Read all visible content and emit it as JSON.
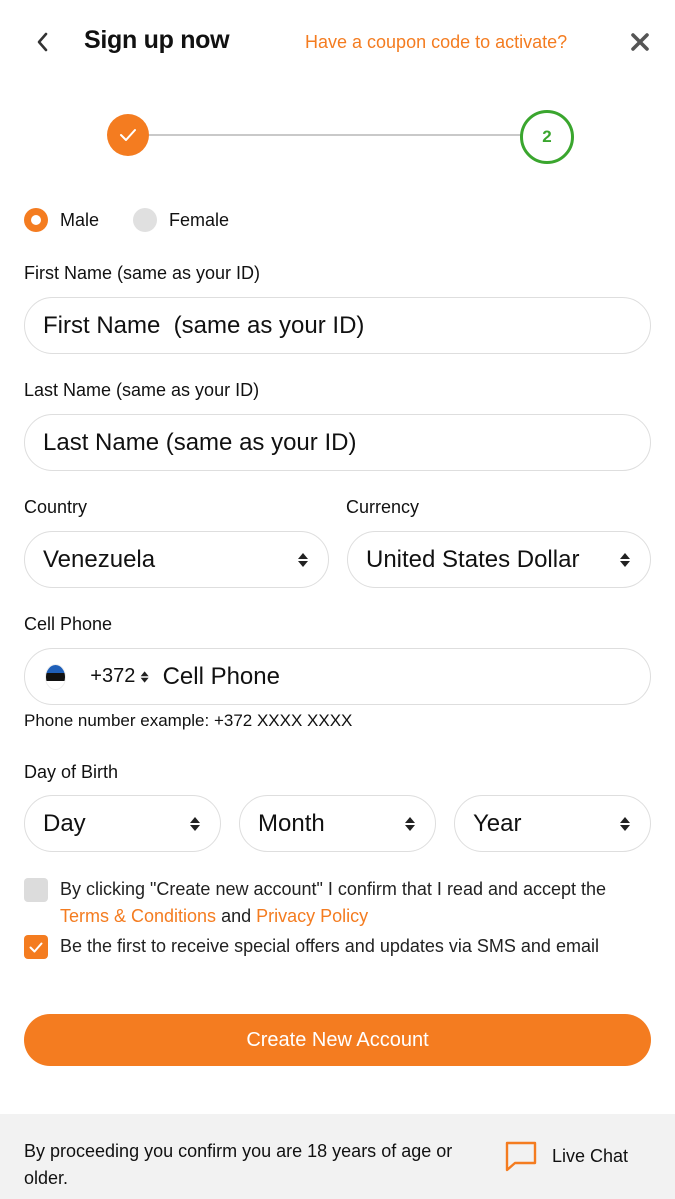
{
  "header": {
    "title": "Sign up now",
    "coupon_link": "Have a coupon code to activate?"
  },
  "stepper": {
    "current_step": "2"
  },
  "gender": {
    "options": [
      "Male",
      "Female"
    ],
    "selected": "Male"
  },
  "first_name": {
    "label": "First Name (same as your ID)",
    "placeholder": "First Name  (same as your ID)"
  },
  "last_name": {
    "label": "Last Name (same as your ID)",
    "placeholder": "Last Name (same as your ID)"
  },
  "country": {
    "label": "Country",
    "value": "Venezuela"
  },
  "currency": {
    "label": "Currency",
    "value": "United States Dollar"
  },
  "phone": {
    "label": "Cell Phone",
    "code": "+372",
    "placeholder": "Cell Phone",
    "example": "Phone number example: +372 XXXX XXXX"
  },
  "birth": {
    "label": "Day of Birth",
    "day": "Day",
    "month": "Month",
    "year": "Year"
  },
  "consent": {
    "text_before": "By clicking \"Create new account\" I confirm that I read and accept the ",
    "terms_link": "Terms & Conditions",
    "and": " and ",
    "privacy_link": "Privacy Policy",
    "checked": false
  },
  "offers": {
    "text": "Be the first to receive special offers and updates via SMS and email",
    "checked": true
  },
  "create_button": "Create New Account",
  "footer": {
    "age_note": "By proceeding you confirm you are 18 years of age or older.",
    "live_chat": "Live Chat"
  },
  "colors": {
    "accent": "#f47c20",
    "step_active": "#3aa62e",
    "footer_bg": "#f2f2f2"
  },
  "icons": {
    "back": "chevron-left-icon",
    "close": "close-icon",
    "step_done": "check-icon",
    "select": "sort-arrows-icon",
    "flag": "estonia-flag-icon",
    "chat": "chat-bubble-icon"
  }
}
